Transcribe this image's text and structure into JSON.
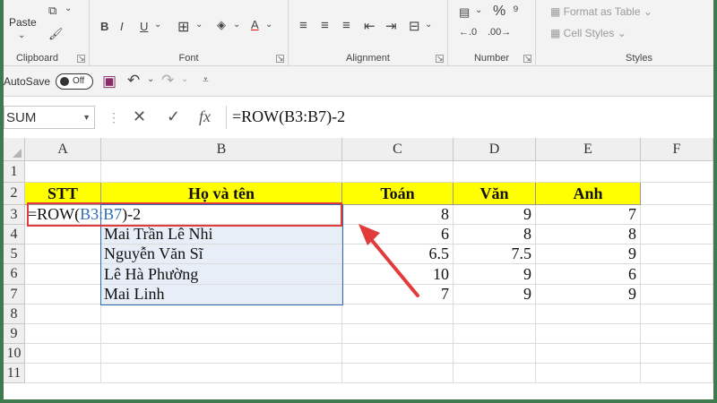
{
  "ribbon": {
    "clipboard": {
      "paste_label": "Paste",
      "group_label": "Clipboard"
    },
    "font": {
      "group_label": "Font",
      "bold": "B",
      "italic": "I",
      "underline": "U"
    },
    "alignment": {
      "group_label": "Alignment"
    },
    "number": {
      "group_label": "Number",
      "percent": "%"
    },
    "styles": {
      "group_label": "Styles",
      "format_as_table": "Format as Table",
      "cell_styles": "Cell Styles"
    }
  },
  "qat": {
    "autosave_label": "AutoSave",
    "toggle_state": "Off"
  },
  "formula_bar": {
    "name_box": "SUM",
    "cancel": "✕",
    "enter": "✓",
    "fx": "fx",
    "formula": "=ROW(B3:B7)-2"
  },
  "columns": [
    "A",
    "B",
    "C",
    "D",
    "E",
    "F"
  ],
  "rows": [
    "1",
    "2",
    "3",
    "4",
    "5",
    "6",
    "7",
    "8",
    "9",
    "10",
    "11"
  ],
  "table": {
    "headers": {
      "stt": "STT",
      "name": "Họ và tên",
      "math": "Toán",
      "lit": "Văn",
      "eng": "Anh"
    },
    "editing_formula": {
      "prefix": "=ROW(",
      "ref": "B3:B7",
      "suffix": ")-2"
    },
    "records": [
      {
        "name": "",
        "math": "8",
        "lit": "9",
        "eng": "7"
      },
      {
        "name": "Mai Trần Lê Nhi",
        "math": "6",
        "lit": "8",
        "eng": "8"
      },
      {
        "name": "Nguyễn Văn Sĩ",
        "math": "6.5",
        "lit": "7.5",
        "eng": "9"
      },
      {
        "name": "Lê Hà Phường",
        "math": "10",
        "lit": "9",
        "eng": "6"
      },
      {
        "name": "Mai Linh",
        "math": "7",
        "lit": "9",
        "eng": "9"
      }
    ]
  }
}
